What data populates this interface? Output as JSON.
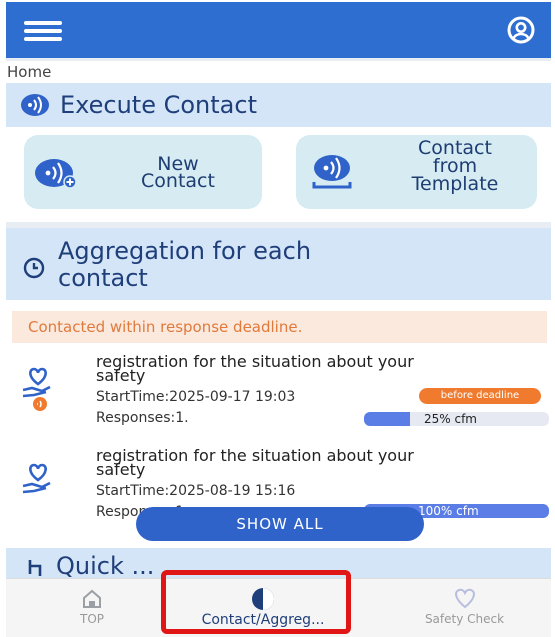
{
  "header": {
    "menu_icon": "hamburger-icon",
    "account_icon": "user-circle-icon",
    "bar_color": "#2f6ed1"
  },
  "breadcrumb": "Home",
  "execute": {
    "title": "Execute Contact",
    "icon": "broadcast-icon",
    "new_contact": {
      "line1": "New",
      "line2": "Contact",
      "icon": "broadcast-plus-icon"
    },
    "template": {
      "line1": "Contact",
      "line2": "from",
      "line3": "Template",
      "icon": "broadcast-template-icon"
    }
  },
  "aggregation": {
    "title_line1": "Aggregation for each",
    "title_line2": "contact",
    "icon": "clock-icon",
    "notice": "Contacted within response deadline.",
    "rows": [
      {
        "title_line1": "registration for the situation about your",
        "title_line2": "safety",
        "start": "StartTime:2025-09-17 19:03",
        "badge": "before deadline",
        "responses": "Responses:1.",
        "progress": 0.25,
        "progress_label": "25% cfm",
        "icon": "heart-hand-icon"
      },
      {
        "title_line1": "registration for the situation about your",
        "title_line2": "safety",
        "start": "StartTime:2025-08-19 15:16",
        "responses": "Responses:1.",
        "progress": 1.0,
        "progress_label": "100% cfm",
        "icon": "heart-hand-icon"
      }
    ],
    "show_all": "SHOW ALL"
  },
  "quick": {
    "title_partial": "Quick ...",
    "icon": "pointer-icon"
  },
  "bottom_nav": [
    {
      "label": "TOP",
      "icon": "home-icon"
    },
    {
      "label": "Contact/Aggreg...",
      "icon": "pie-chart-icon",
      "active": true
    },
    {
      "label": "Safety Check",
      "icon": "heart-icon"
    }
  ],
  "colors": {
    "primary": "#2f6ed1",
    "accent_orange": "#f07b2e",
    "highlight_red": "#e01616",
    "heading": "#1f3f7a"
  }
}
